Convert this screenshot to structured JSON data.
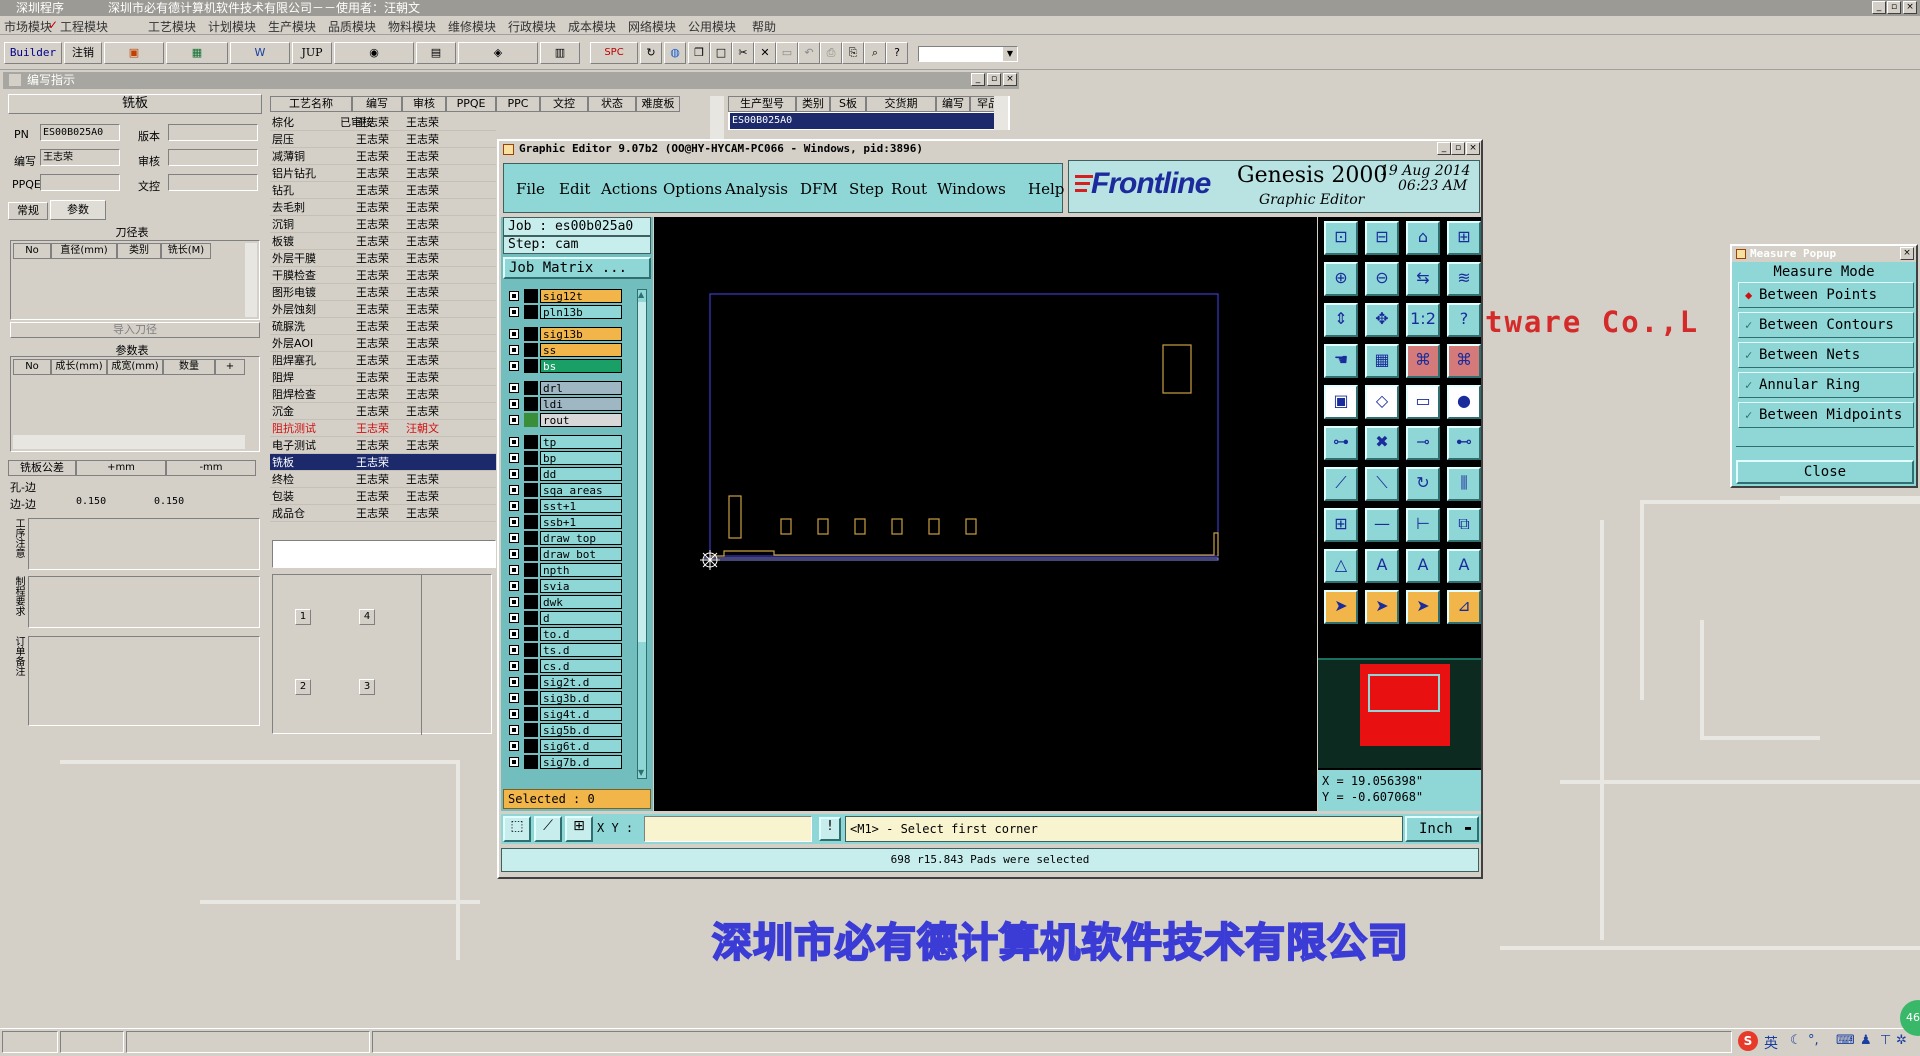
{
  "app": {
    "title": "深圳程序",
    "title_company": "深圳市必有德计算机软件技术有限公司－－使用者：汪朝文"
  },
  "menubar": [
    "市场模块",
    "工程模块",
    "工艺模块",
    "计划模块",
    "生产模块",
    "品质模块",
    "物料模块",
    "维修模块",
    "行政模块",
    "成本模块",
    "网络模块",
    "公用模块",
    "帮助"
  ],
  "toolbar": {
    "builder": "Builder",
    "logout": "注销",
    "jup": "JUP",
    "spc": "SPC"
  },
  "left_panel": {
    "title": "编写指示",
    "section_title": "铣板",
    "pn_label": "PN",
    "pn_value": "ES00B025A0",
    "version_label": "版本",
    "editor_label": "编写",
    "editor_value": "王志荣",
    "review_label": "审核",
    "ppqe_label": "PPQE",
    "doc_label": "文控",
    "tabs": [
      "常规",
      "参数"
    ],
    "tool_table_title": "刀径表",
    "tool_cols": [
      "No",
      "直径(mm)",
      "类别",
      "铣长(M)"
    ],
    "import_button": "导入刀径",
    "param_table_title": "参数表",
    "param_cols": [
      "No",
      "成长(mm)",
      "成宽(mm)",
      "数量",
      "+"
    ],
    "tolerance": {
      "cols": [
        "铣板公差",
        "+mm",
        "-mm"
      ],
      "rows": [
        {
          "name": "孔-边",
          "plus": "",
          "minus": ""
        },
        {
          "name": "边-边",
          "plus": "0.150",
          "minus": "0.150"
        }
      ]
    },
    "notes": [
      "工序注意",
      "制程要求",
      "订单备注"
    ],
    "process_cols": [
      "工艺名称",
      "编写",
      "审核",
      "PPQE",
      "PPC",
      "文控",
      "状态",
      "难度板"
    ],
    "processes": [
      {
        "name": "棕化",
        "editor": "王志荣",
        "reviewer": "王志荣",
        "status": "已审核",
        "hl": false,
        "red": false
      },
      {
        "name": "层压",
        "editor": "王志荣",
        "reviewer": "王志荣",
        "status": "",
        "hl": false,
        "red": false
      },
      {
        "name": "减薄铜",
        "editor": "王志荣",
        "reviewer": "王志荣",
        "status": "",
        "hl": false,
        "red": false
      },
      {
        "name": "铝片钻孔",
        "editor": "王志荣",
        "reviewer": "王志荣",
        "status": "",
        "hl": false,
        "red": false
      },
      {
        "name": "钻孔",
        "editor": "王志荣",
        "reviewer": "王志荣",
        "status": "",
        "hl": false,
        "red": false
      },
      {
        "name": "去毛刺",
        "editor": "王志荣",
        "reviewer": "王志荣",
        "status": "",
        "hl": false,
        "red": false
      },
      {
        "name": "沉铜",
        "editor": "王志荣",
        "reviewer": "王志荣",
        "status": "",
        "hl": false,
        "red": false
      },
      {
        "name": "板镀",
        "editor": "王志荣",
        "reviewer": "王志荣",
        "status": "",
        "hl": false,
        "red": false
      },
      {
        "name": "外层干膜",
        "editor": "王志荣",
        "reviewer": "王志荣",
        "status": "",
        "hl": false,
        "red": false
      },
      {
        "name": "干膜检查",
        "editor": "王志荣",
        "reviewer": "王志荣",
        "status": "",
        "hl": false,
        "red": false
      },
      {
        "name": "图形电镀",
        "editor": "王志荣",
        "reviewer": "王志荣",
        "status": "",
        "hl": false,
        "red": false
      },
      {
        "name": "外层蚀刻",
        "editor": "王志荣",
        "reviewer": "王志荣",
        "status": "",
        "hl": false,
        "red": false
      },
      {
        "name": "硫脲洗",
        "editor": "王志荣",
        "reviewer": "王志荣",
        "status": "",
        "hl": false,
        "red": false
      },
      {
        "name": "外层AOI",
        "editor": "王志荣",
        "reviewer": "王志荣",
        "status": "",
        "hl": false,
        "red": false
      },
      {
        "name": "阻焊塞孔",
        "editor": "王志荣",
        "reviewer": "王志荣",
        "status": "",
        "hl": false,
        "red": false
      },
      {
        "name": "阻焊",
        "editor": "王志荣",
        "reviewer": "王志荣",
        "status": "",
        "hl": false,
        "red": false
      },
      {
        "name": "阻焊检查",
        "editor": "王志荣",
        "reviewer": "王志荣",
        "status": "",
        "hl": false,
        "red": false
      },
      {
        "name": "沉金",
        "editor": "王志荣",
        "reviewer": "王志荣",
        "status": "",
        "hl": false,
        "red": false
      },
      {
        "name": "阻抗测试",
        "editor": "王志荣",
        "reviewer": "汪朝文",
        "status": "",
        "hl": false,
        "red": true
      },
      {
        "name": "电子测试",
        "editor": "王志荣",
        "reviewer": "王志荣",
        "status": "",
        "hl": false,
        "red": false
      },
      {
        "name": "铣板",
        "editor": "王志荣",
        "reviewer": "",
        "status": "",
        "hl": true,
        "red": false
      },
      {
        "name": "终检",
        "editor": "王志荣",
        "reviewer": "王志荣",
        "status": "",
        "hl": false,
        "red": false
      },
      {
        "name": "包装",
        "editor": "王志荣",
        "reviewer": "王志荣",
        "status": "",
        "hl": false,
        "red": false
      },
      {
        "name": "成品仓",
        "editor": "王志荣",
        "reviewer": "王志荣",
        "status": "",
        "hl": false,
        "red": false
      }
    ],
    "order_cols": [
      "生产型号",
      "类别",
      "S板",
      "交货期",
      "编写",
      "罕品"
    ],
    "order_row": "ES00B025A0",
    "box_numbers": [
      "1",
      "4",
      "2",
      "3"
    ]
  },
  "editor": {
    "title": "Graphic Editor 9.07b2 (OO@HY-HYCAM-PC066 - Windows, pid:3896)",
    "menu": [
      "File",
      "Edit",
      "Actions",
      "Options",
      "Analysis",
      "DFM",
      "Step",
      "Rout",
      "Windows",
      "Help"
    ],
    "brand": "Frontline",
    "product": "Genesis 2000",
    "subtitle": "Graphic Editor",
    "date": "19 Aug 2014",
    "time": "06:23 AM",
    "job": "Job : es00b025a0",
    "step": "Step: cam",
    "job_matrix": "Job Matrix ...",
    "layers": [
      {
        "name": "sig12t",
        "bg": "#f2b54a",
        "sw": "#000"
      },
      {
        "name": "pln13b",
        "bg": "#8fd6d6",
        "sw": "#000"
      },
      {
        "name": "sig13b",
        "bg": "#f2b54a",
        "sw": "#000"
      },
      {
        "name": "ss",
        "bg": "#f2b54a",
        "sw": "#000"
      },
      {
        "name": "bs",
        "bg": "#1aa067",
        "sw": "#000"
      },
      {
        "name": "drl",
        "bg": "#9fb6c3",
        "sw": "#000"
      },
      {
        "name": "ldi",
        "bg": "#9fb6c3",
        "sw": "#000"
      },
      {
        "name": "rout",
        "bg": "#d8d8d8",
        "sw": "#3a8e3a"
      },
      {
        "name": "tp",
        "bg": "#8fd6d6",
        "sw": "#000"
      },
      {
        "name": "bp",
        "bg": "#8fd6d6",
        "sw": "#000"
      },
      {
        "name": "dd",
        "bg": "#8fd6d6",
        "sw": "#000"
      },
      {
        "name": "sqa_areas",
        "bg": "#8fd6d6",
        "sw": "#000"
      },
      {
        "name": "sst+1",
        "bg": "#8fd6d6",
        "sw": "#000"
      },
      {
        "name": "ssb+1",
        "bg": "#8fd6d6",
        "sw": "#000"
      },
      {
        "name": "draw_top",
        "bg": "#8fd6d6",
        "sw": "#000"
      },
      {
        "name": "draw_bot",
        "bg": "#8fd6d6",
        "sw": "#000"
      },
      {
        "name": "npth",
        "bg": "#8fd6d6",
        "sw": "#000"
      },
      {
        "name": "svia",
        "bg": "#8fd6d6",
        "sw": "#000"
      },
      {
        "name": "dwk",
        "bg": "#8fd6d6",
        "sw": "#000"
      },
      {
        "name": "d",
        "bg": "#8fd6d6",
        "sw": "#000"
      },
      {
        "name": "to.d",
        "bg": "#8fd6d6",
        "sw": "#000"
      },
      {
        "name": "ts.d",
        "bg": "#8fd6d6",
        "sw": "#000"
      },
      {
        "name": "cs.d",
        "bg": "#8fd6d6",
        "sw": "#000"
      },
      {
        "name": "sig2t.d",
        "bg": "#8fd6d6",
        "sw": "#000"
      },
      {
        "name": "sig3b.d",
        "bg": "#8fd6d6",
        "sw": "#000"
      },
      {
        "name": "sig4t.d",
        "bg": "#8fd6d6",
        "sw": "#000"
      },
      {
        "name": "sig5b.d",
        "bg": "#8fd6d6",
        "sw": "#000"
      },
      {
        "name": "sig6t.d",
        "bg": "#8fd6d6",
        "sw": "#000"
      },
      {
        "name": "sig7b.d",
        "bg": "#8fd6d6",
        "sw": "#000"
      }
    ],
    "selected": "Selected : 0",
    "coords_x": "X = 19.056398\"",
    "coords_y": "Y = -0.607068\"",
    "xy_label": "X Y :",
    "xy_value": "",
    "prompt": "<M1> - Select first corner",
    "units": "Inch",
    "status": "698 r15.843 Pads were selected"
  },
  "measure_popup": {
    "title": "Measure Popup",
    "mode_label": "Measure Mode",
    "options": [
      "Between Points",
      "Between Contours",
      "Between Nets",
      "Annular Ring",
      "Between Midpoints"
    ],
    "selected_index": 0,
    "close": "Close"
  },
  "background": {
    "watermark_en": "tware Co.,L",
    "watermark_cn": "深圳市必有德计算机软件技术有限公司"
  },
  "taskbar": {
    "ime": "英",
    "badge": "46"
  }
}
